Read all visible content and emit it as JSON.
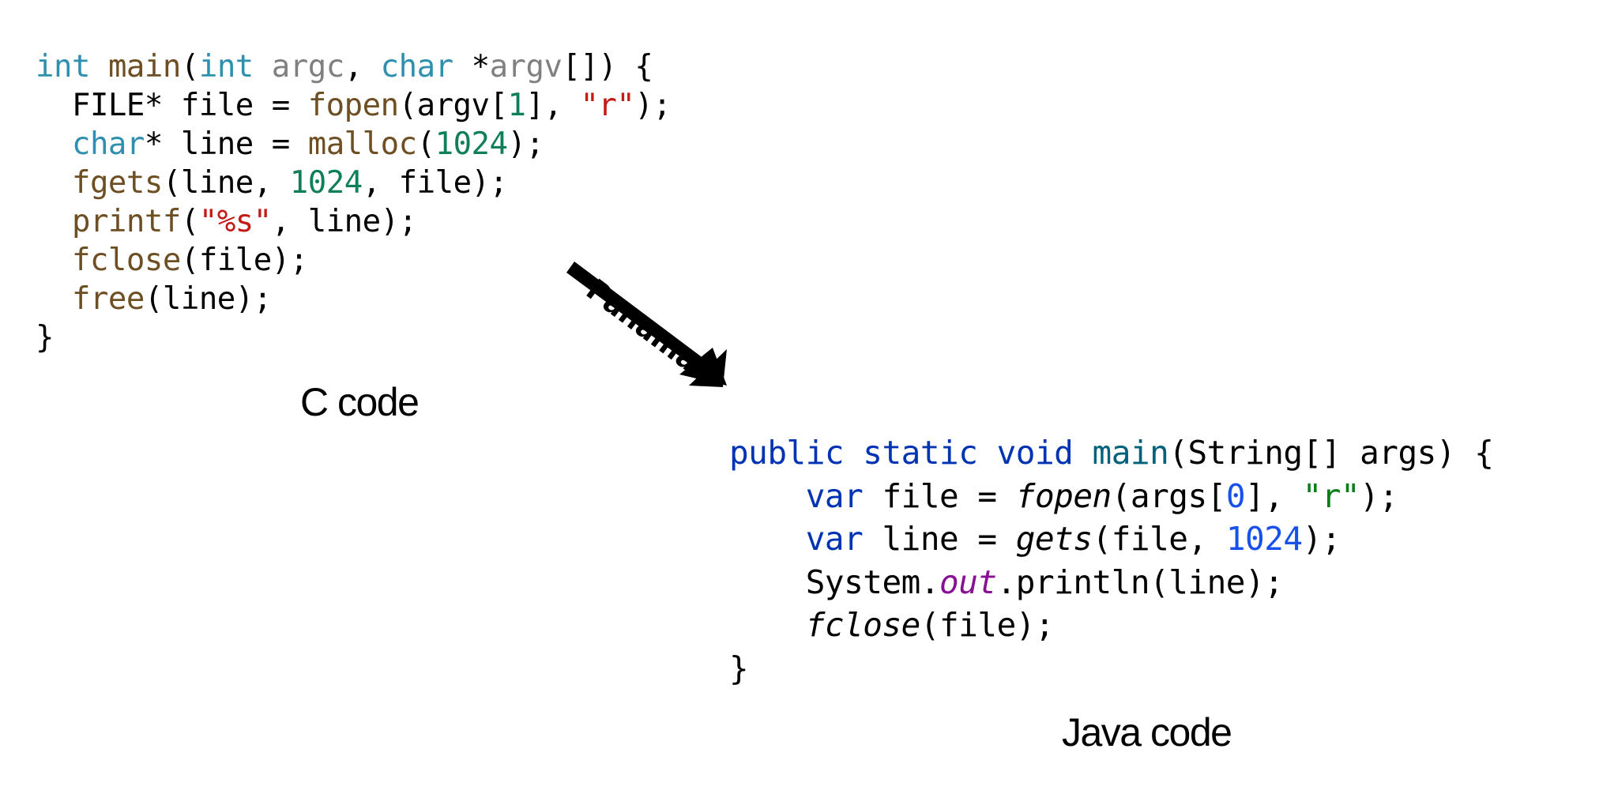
{
  "colors": {
    "c_type": "#2f8fae",
    "c_func": "#6e4f23",
    "c_param": "#808080",
    "c_number": "#0f7f58",
    "c_string": "#c41a16",
    "c_plain": "#000000",
    "java_keyword": "#0033b3",
    "java_method_decl": "#00627a",
    "java_number": "#1750eb",
    "java_string": "#067d17",
    "java_static_field": "#871094",
    "java_plain": "#000000"
  },
  "c_code": {
    "caption": "C code",
    "lines": [
      [
        {
          "t": "int",
          "c": "c_type"
        },
        {
          "t": " ",
          "c": "c_plain"
        },
        {
          "t": "main",
          "c": "c_func"
        },
        {
          "t": "(",
          "c": "c_plain"
        },
        {
          "t": "int",
          "c": "c_type"
        },
        {
          "t": " ",
          "c": "c_plain"
        },
        {
          "t": "argc",
          "c": "c_param"
        },
        {
          "t": ", ",
          "c": "c_plain"
        },
        {
          "t": "char",
          "c": "c_type"
        },
        {
          "t": " *",
          "c": "c_plain"
        },
        {
          "t": "argv",
          "c": "c_param"
        },
        {
          "t": "[]) {",
          "c": "c_plain"
        }
      ],
      [
        {
          "t": "  FILE* file = ",
          "c": "c_plain"
        },
        {
          "t": "fopen",
          "c": "c_func"
        },
        {
          "t": "(argv[",
          "c": "c_plain"
        },
        {
          "t": "1",
          "c": "c_number"
        },
        {
          "t": "], ",
          "c": "c_plain"
        },
        {
          "t": "\"r\"",
          "c": "c_string"
        },
        {
          "t": ");",
          "c": "c_plain"
        }
      ],
      [
        {
          "t": "  ",
          "c": "c_plain"
        },
        {
          "t": "char",
          "c": "c_type"
        },
        {
          "t": "* line = ",
          "c": "c_plain"
        },
        {
          "t": "malloc",
          "c": "c_func"
        },
        {
          "t": "(",
          "c": "c_plain"
        },
        {
          "t": "1024",
          "c": "c_number"
        },
        {
          "t": ");",
          "c": "c_plain"
        }
      ],
      [
        {
          "t": "  ",
          "c": "c_plain"
        },
        {
          "t": "fgets",
          "c": "c_func"
        },
        {
          "t": "(line, ",
          "c": "c_plain"
        },
        {
          "t": "1024",
          "c": "c_number"
        },
        {
          "t": ", file);",
          "c": "c_plain"
        }
      ],
      [
        {
          "t": "  ",
          "c": "c_plain"
        },
        {
          "t": "printf",
          "c": "c_func"
        },
        {
          "t": "(",
          "c": "c_plain"
        },
        {
          "t": "\"%s\"",
          "c": "c_string"
        },
        {
          "t": ", line);",
          "c": "c_plain"
        }
      ],
      [
        {
          "t": "  ",
          "c": "c_plain"
        },
        {
          "t": "fclose",
          "c": "c_func"
        },
        {
          "t": "(file);",
          "c": "c_plain"
        }
      ],
      [
        {
          "t": "  ",
          "c": "c_plain"
        },
        {
          "t": "free",
          "c": "c_func"
        },
        {
          "t": "(line);",
          "c": "c_plain"
        }
      ],
      [
        {
          "t": "}",
          "c": "c_plain"
        }
      ]
    ]
  },
  "arrow": {
    "label": "Panama",
    "icon": "arrow-down-right-icon"
  },
  "java_code": {
    "caption": "Java code",
    "lines": [
      [
        {
          "t": "public",
          "c": "java_keyword"
        },
        {
          "t": " ",
          "c": "java_plain"
        },
        {
          "t": "static",
          "c": "java_keyword"
        },
        {
          "t": " ",
          "c": "java_plain"
        },
        {
          "t": "void",
          "c": "java_keyword"
        },
        {
          "t": " ",
          "c": "java_plain"
        },
        {
          "t": "main",
          "c": "java_method_decl"
        },
        {
          "t": "(String[] args) {",
          "c": "java_plain"
        }
      ],
      [
        {
          "t": "    ",
          "c": "java_plain"
        },
        {
          "t": "var",
          "c": "java_keyword"
        },
        {
          "t": " file = ",
          "c": "java_plain"
        },
        {
          "t": "fopen",
          "c": "java_plain",
          "i": true
        },
        {
          "t": "(args[",
          "c": "java_plain"
        },
        {
          "t": "0",
          "c": "java_number"
        },
        {
          "t": "], ",
          "c": "java_plain"
        },
        {
          "t": "\"r\"",
          "c": "java_string"
        },
        {
          "t": ");",
          "c": "java_plain"
        }
      ],
      [
        {
          "t": "    ",
          "c": "java_plain"
        },
        {
          "t": "var",
          "c": "java_keyword"
        },
        {
          "t": " line = ",
          "c": "java_plain"
        },
        {
          "t": "gets",
          "c": "java_plain",
          "i": true
        },
        {
          "t": "(file, ",
          "c": "java_plain"
        },
        {
          "t": "1024",
          "c": "java_number"
        },
        {
          "t": ");",
          "c": "java_plain"
        }
      ],
      [
        {
          "t": "    System.",
          "c": "java_plain"
        },
        {
          "t": "out",
          "c": "java_static_field",
          "i": true
        },
        {
          "t": ".println(line);",
          "c": "java_plain"
        }
      ],
      [
        {
          "t": "    ",
          "c": "java_plain"
        },
        {
          "t": "fclose",
          "c": "java_plain",
          "i": true
        },
        {
          "t": "(file);",
          "c": "java_plain"
        }
      ],
      [
        {
          "t": "}",
          "c": "java_plain"
        }
      ]
    ]
  }
}
